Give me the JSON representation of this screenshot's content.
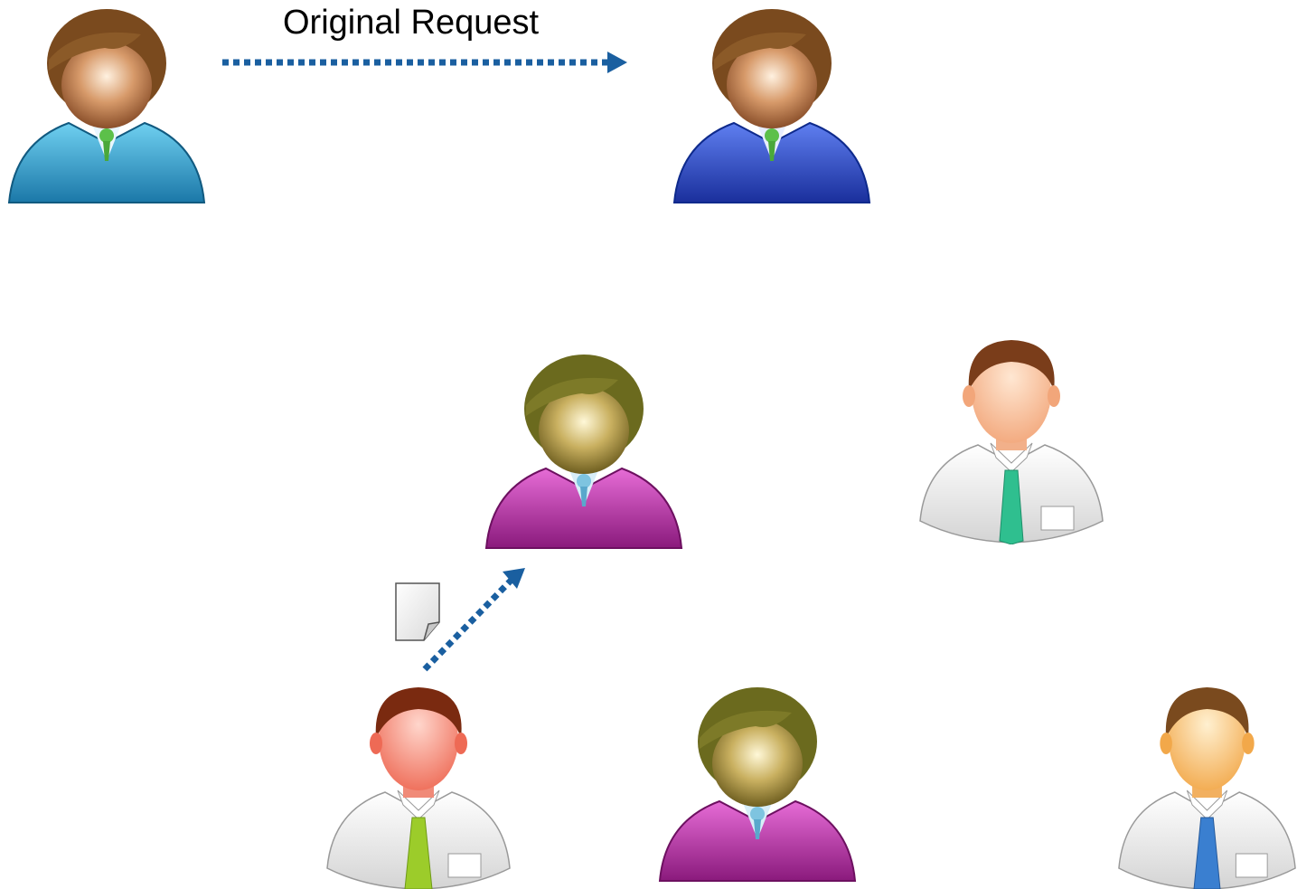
{
  "diagram": {
    "label": "Original Request",
    "arrow_color": "#1a5fa0",
    "people": [
      {
        "id": "sender",
        "style": "glossy",
        "suit": "#3aa7d4",
        "suit_dark": "#1b6f9a",
        "hair": "#7a4a1e",
        "face": "#c9875a"
      },
      {
        "id": "receiver",
        "style": "glossy",
        "suit": "#2a4fd0",
        "suit_dark": "#0e2a8c",
        "hair": "#7a4a1e",
        "face": "#c9875a"
      },
      {
        "id": "middle-magenta",
        "style": "glossy",
        "suit": "#c62fb0",
        "suit_dark": "#7d1570",
        "hair": "#6b6a1e",
        "face": "#b9a55a"
      },
      {
        "id": "top-right-white",
        "style": "flat",
        "shirt": "#f2f2f2",
        "tie": "#2fbf8f",
        "hair": "#7a3d1a",
        "face": "#f7c6a0"
      },
      {
        "id": "bottom-left-white",
        "style": "flat",
        "shirt": "#f2f2f2",
        "tie": "#9ccc2a",
        "hair": "#7a2a10",
        "face": "#f08a78"
      },
      {
        "id": "bottom-magenta",
        "style": "glossy",
        "suit": "#c62fb0",
        "suit_dark": "#7d1570",
        "hair": "#6b6a1e",
        "face": "#b9a55a"
      },
      {
        "id": "bottom-right-white",
        "style": "flat",
        "shirt": "#f2f2f2",
        "tie": "#3a7fd0",
        "hair": "#7a4a1e",
        "face": "#f6c17a"
      }
    ]
  }
}
